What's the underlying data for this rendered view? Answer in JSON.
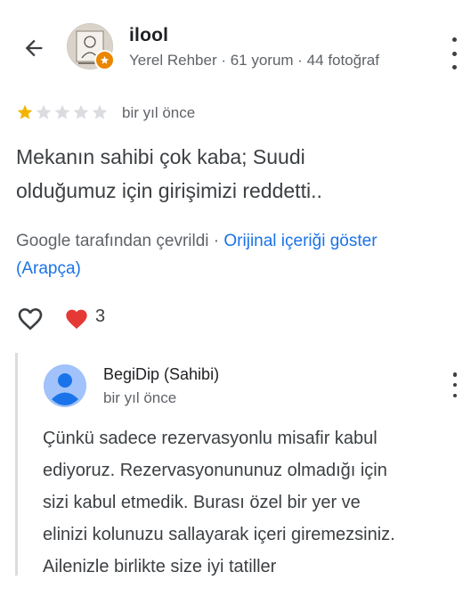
{
  "reviewer": {
    "name": "ilool",
    "meta": "Yerel Rehber · 61 yorum · 44 fotoğraf"
  },
  "review": {
    "rating": 1,
    "max_rating": 5,
    "time": "bir yıl önce",
    "text_line1": "Mekanın sahibi çok kaba; Suudi",
    "text_line2": "olduğumuz için girişimizi reddetti..",
    "translated_by": "Google tarafından çevrildi · ",
    "show_original": "Orijinal içeriği göster",
    "original_language": "(Arapça)",
    "like_count": "3"
  },
  "owner_response": {
    "name": "BegiDip (Sahibi)",
    "time": "bir yıl önce",
    "lines": [
      "Çünkü sadece rezervasyonlu misafir kabul",
      "ediyoruz. Rezervasyonununuz olmadığı için",
      "sizi kabul etmedik. Burası özel bir yer ve",
      "elinizi kolunuzu sallayarak içeri giremezsiniz.",
      "Ailenizle birlikte size iyi tatiller"
    ]
  },
  "colors": {
    "star_filled": "#f4b400",
    "star_empty": "#dadce0",
    "link": "#1a73e8",
    "heart": "#e53935",
    "badge": "#ea8600",
    "owner_avatar": "#a1c2fa"
  },
  "icons": {
    "back": "arrow-left-icon",
    "more": "more-vert-icon",
    "like": "heart-outline-icon",
    "reaction": "heart-filled-icon",
    "badge": "local-guide-star-icon",
    "owner_avatar": "person-icon"
  }
}
